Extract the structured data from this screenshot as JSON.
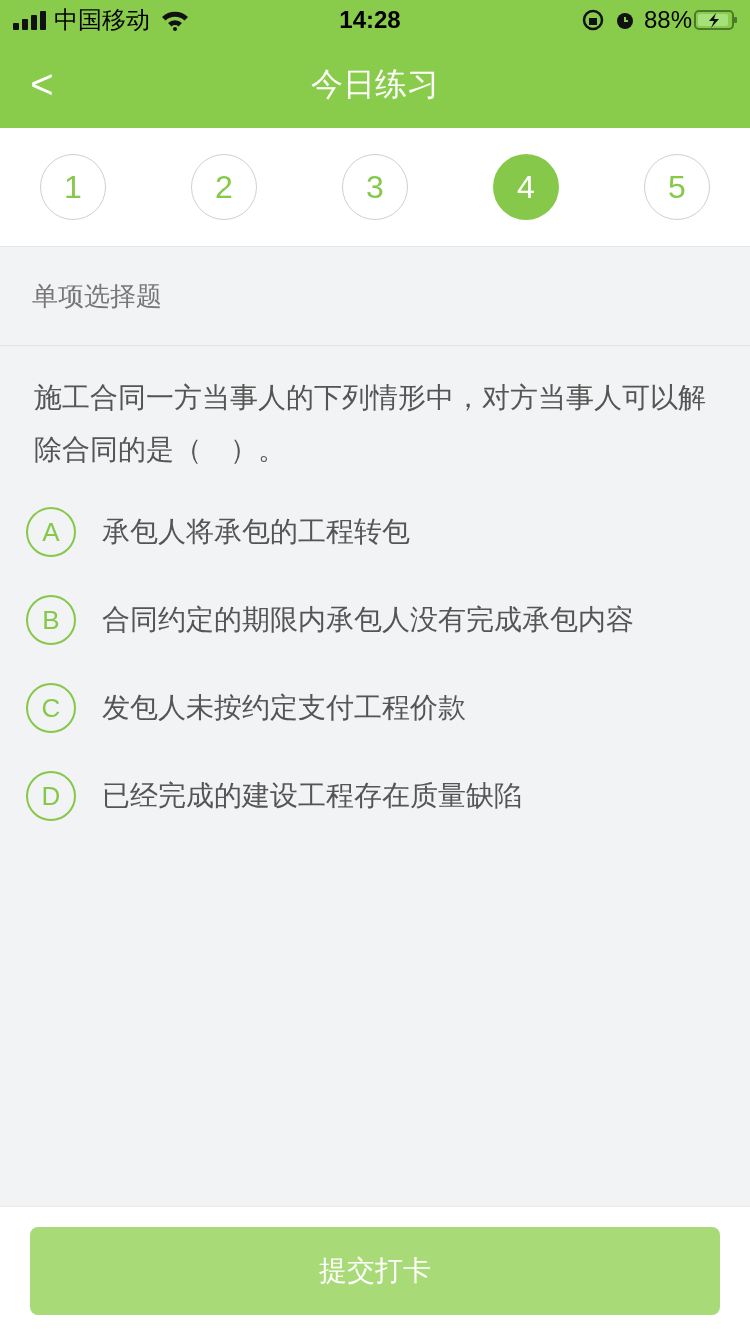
{
  "status_bar": {
    "carrier": "中国移动",
    "time": "14:28",
    "battery": "88%"
  },
  "nav": {
    "title": "今日练习",
    "back": "<"
  },
  "questions": [
    {
      "label": "1",
      "selected": false
    },
    {
      "label": "2",
      "selected": false
    },
    {
      "label": "3",
      "selected": false
    },
    {
      "label": "4",
      "selected": true
    },
    {
      "label": "5",
      "selected": false
    }
  ],
  "section": "单项选择题",
  "question": "施工合同一方当事人的下列情形中，对方当事人可以解除合同的是（　）。",
  "options": [
    {
      "letter": "A",
      "text": "承包人将承包的工程转包",
      "selected": false
    },
    {
      "letter": "B",
      "text": "合同约定的期限内承包人没有完成承包内容",
      "selected": false
    },
    {
      "letter": "C",
      "text": "发包人未按约定支付工程价款",
      "selected": false
    },
    {
      "letter": "D",
      "text": "已经完成的建设工程存在质量缺陷",
      "selected": false
    }
  ],
  "submit": {
    "label": "提交打卡",
    "disabled": true
  }
}
